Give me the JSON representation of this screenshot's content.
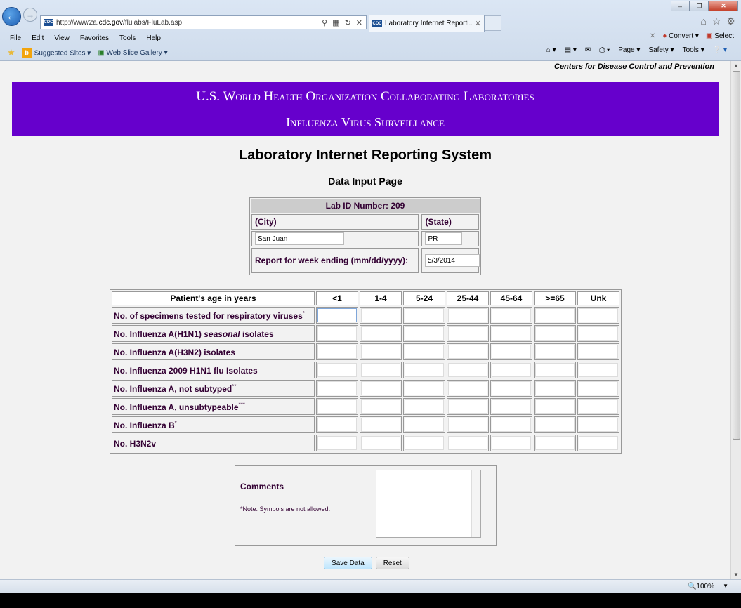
{
  "browser": {
    "address_url_prefix": "http://www2a.",
    "address_url_domain": "cdc.gov",
    "address_url_suffix": "/flulabs/FluLab.asp",
    "tab_title": "Laboratory Internet Reporti...",
    "favicon_text": "CDC",
    "menu": [
      "File",
      "Edit",
      "View",
      "Favorites",
      "Tools",
      "Help"
    ],
    "convert_label": "Convert",
    "select_label": "Select",
    "favorites": {
      "suggested": "Suggested Sites",
      "webslice": "Web Slice Gallery"
    },
    "cmd": {
      "page": "Page",
      "safety": "Safety",
      "tools": "Tools"
    },
    "zoom": "100%"
  },
  "page": {
    "agency": "Centers for Disease Control and Prevention",
    "banner_line1": "U.S. World Health Organization Collaborating Laboratories",
    "banner_line2": "Influenza Virus Surveillance",
    "title": "Laboratory Internet Reporting System",
    "subtitle": "Data Input Page",
    "lab": {
      "header": "Lab ID Number: 209",
      "city_label": "(City)",
      "state_label": "(State)",
      "city_value": "San Juan",
      "state_value": "PR",
      "week_label": "Report for week ending (mm/dd/yyyy):",
      "week_value": "5/3/2014"
    },
    "grid": {
      "age_header": "Patient's age in years",
      "columns": [
        "<1",
        "1-4",
        "5-24",
        "25-44",
        "45-64",
        ">=65",
        "Unk"
      ],
      "rows": [
        {
          "pre": "No. of specimens tested for respiratory viruses",
          "em": "",
          "post": "",
          "sup": "*"
        },
        {
          "pre": "No. Influenza A(H1N1) ",
          "em": "seasonal",
          "post": " isolates",
          "sup": ""
        },
        {
          "pre": "No. Influenza A(H3N2) isolates",
          "em": "",
          "post": "",
          "sup": ""
        },
        {
          "pre": "No. Influenza 2009 H1N1 flu Isolates",
          "em": "",
          "post": "",
          "sup": ""
        },
        {
          "pre": "No. Influenza A, not subtyped",
          "em": "",
          "post": "",
          "sup": "**"
        },
        {
          "pre": "No. Influenza A, unsubtypeable",
          "em": "",
          "post": "",
          "sup": "***"
        },
        {
          "pre": "No. Influenza B",
          "em": "",
          "post": "",
          "sup": "*"
        },
        {
          "pre": "No. H3N2v",
          "em": "",
          "post": "",
          "sup": ""
        }
      ]
    },
    "comments_label": "Comments",
    "comments_note": "*Note: Symbols are not allowed.",
    "save_label": "Save Data",
    "reset_label": "Reset"
  }
}
